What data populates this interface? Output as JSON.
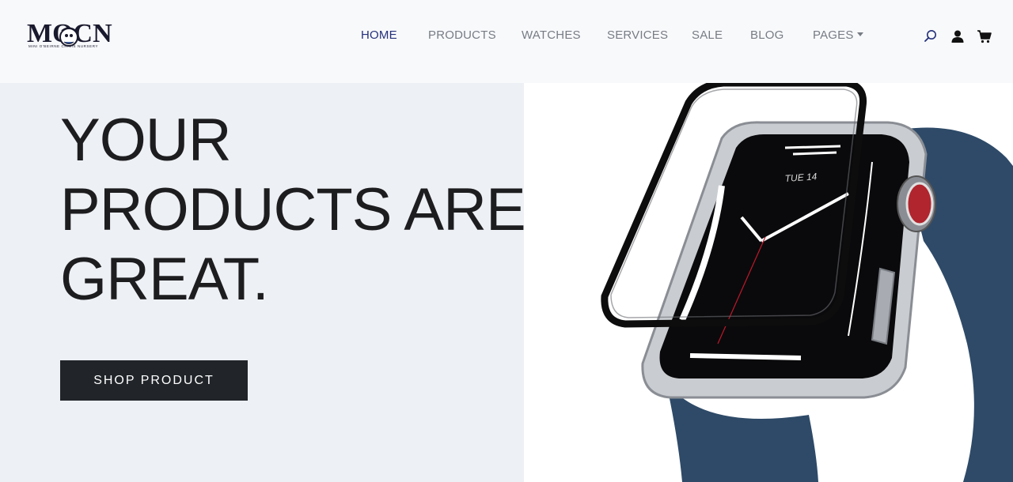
{
  "logo": {
    "text": "MOCN",
    "subtitle": "MINI O'BEIRNE CRISIS NURSERY"
  },
  "nav": {
    "items": [
      {
        "label": "HOME",
        "active": true
      },
      {
        "label": "PRODUCTS",
        "active": false
      },
      {
        "label": "WATCHES",
        "active": false
      },
      {
        "label": "SERVICES",
        "active": false
      },
      {
        "label": "SALE",
        "active": false
      },
      {
        "label": "BLOG",
        "active": false
      },
      {
        "label": "PAGES",
        "active": false,
        "has_dropdown": true
      }
    ],
    "icons": [
      "search-icon",
      "user-icon",
      "cart-icon"
    ]
  },
  "hero": {
    "title_lines": [
      "YOUR",
      "PRODUCTS ARE",
      "GREAT."
    ],
    "cta_label": "SHOP PRODUCT",
    "watch_date": "TUE 14"
  },
  "colors": {
    "header_bg": "#f8f9fb",
    "hero_left_bg": "#edf0f4",
    "active_nav": "#25317a",
    "nav_text": "#777c84",
    "button_bg": "#212529",
    "band_blue": "#2e4a68"
  }
}
